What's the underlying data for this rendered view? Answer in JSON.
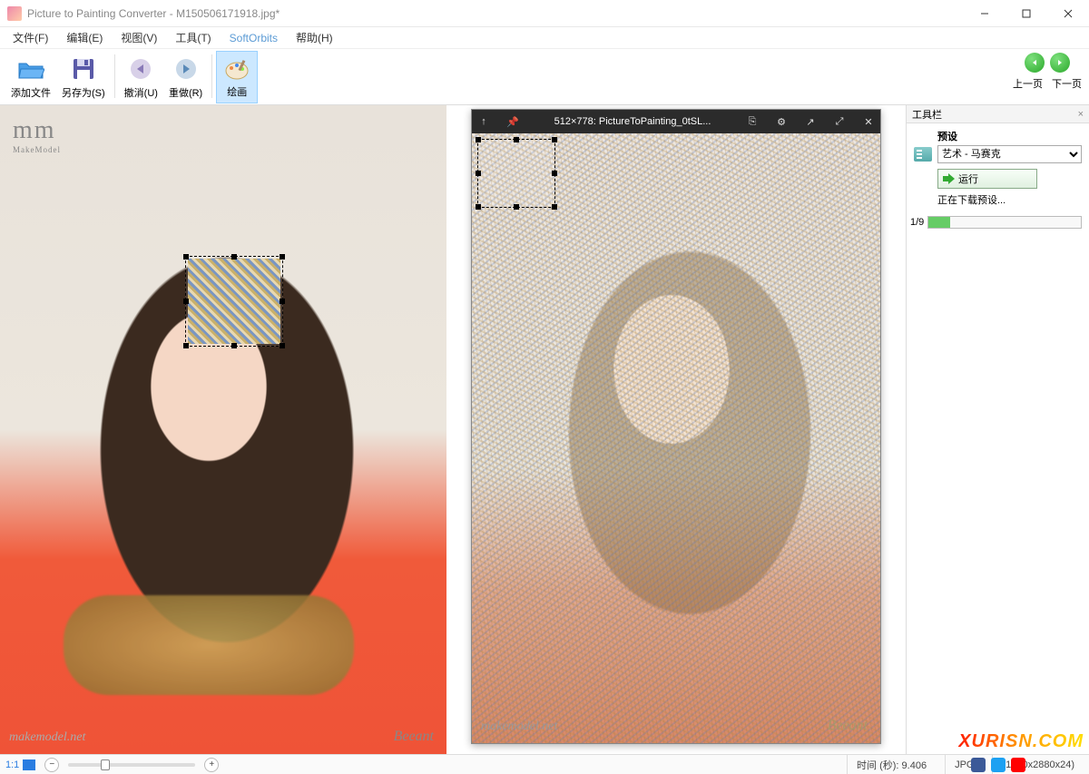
{
  "window": {
    "title": "Picture to Painting Converter - M150506171918.jpg*"
  },
  "menu": {
    "file": "文件(F)",
    "edit": "编辑(E)",
    "view": "视图(V)",
    "tools": "工具(T)",
    "softorbits": "SoftOrbits",
    "help": "帮助(H)"
  },
  "toolbar": {
    "add_file": "添加文件",
    "save_as": "另存为(S)",
    "undo": "撤消(U)",
    "redo": "重做(R)",
    "paint": "绘画",
    "prev": "上一页",
    "next": "下一页"
  },
  "left_image": {
    "watermark_logo_big": "mm",
    "watermark_logo_small": "MakeModel",
    "watermark_url": "makemodel.net",
    "watermark_author": "Beeant"
  },
  "preview": {
    "title": "512×778: PictureToPainting_0tSL...",
    "watermark_url": "makemodel.net",
    "watermark_author": "Beeant"
  },
  "sidepanel": {
    "title": "工具栏",
    "preset_label": "预设",
    "preset_value": "艺术 - 马赛克",
    "run_label": "运行",
    "download_status": "正在下载预设...",
    "progress_text": "1/9"
  },
  "status": {
    "zoom": "1:1",
    "time_label": "时间 (秒): 9.406",
    "format": "JPG",
    "dimensions": "(1920x2880x24)"
  },
  "brand_watermark": "XURISN.COM"
}
